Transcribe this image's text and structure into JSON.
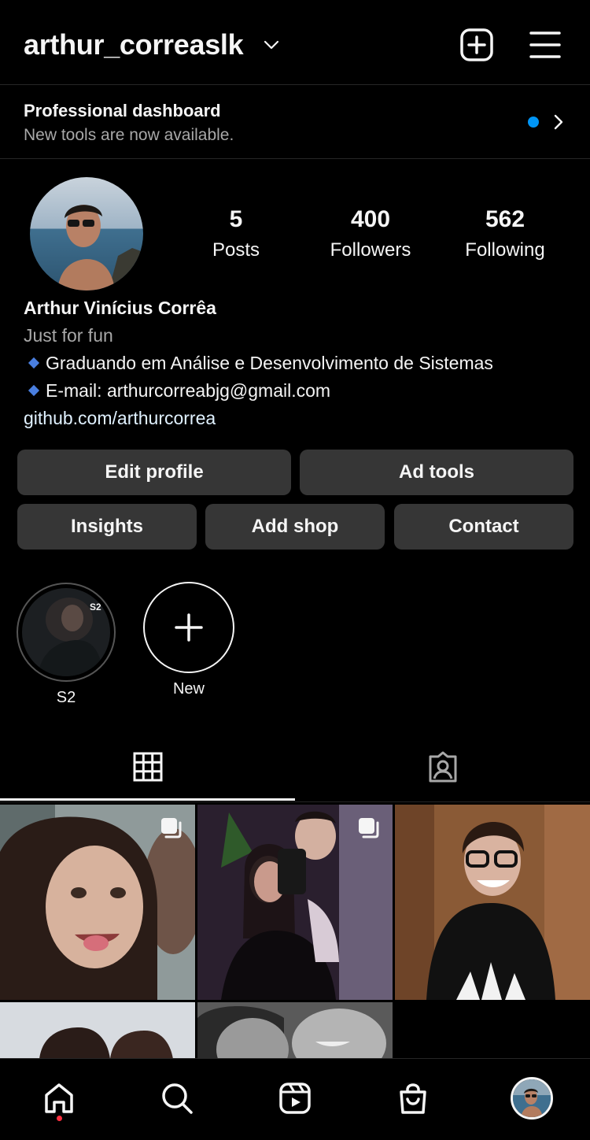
{
  "header": {
    "username": "arthur_correaslk",
    "icons": {
      "chevron": "chevron-down-icon",
      "add": "add-post-icon",
      "menu": "hamburger-menu-icon"
    }
  },
  "dashboard": {
    "title": "Professional dashboard",
    "subtitle": "New tools are now available.",
    "dot_color": "#0095f6"
  },
  "profile": {
    "stats": [
      {
        "value": "5",
        "label": "Posts"
      },
      {
        "value": "400",
        "label": "Followers"
      },
      {
        "value": "562",
        "label": "Following"
      }
    ],
    "name": "Arthur Vinícius Corrêa",
    "category": "Just for fun",
    "bio_lines": [
      "Graduando em Análise e Desenvolvimento de Sistemas",
      "E-mail: arthurcorreabjg@gmail.com"
    ],
    "link": "github.com/arthurcorrea",
    "bullet_color": "#4a7fe0"
  },
  "actions": {
    "row1": [
      "Edit profile",
      "Ad tools"
    ],
    "row2": [
      "Insights",
      "Add shop",
      "Contact"
    ]
  },
  "highlights": [
    {
      "label": "S2",
      "badge": "S2"
    },
    {
      "label": "New"
    }
  ],
  "tabs": {
    "grid_icon": "grid-icon",
    "tagged_icon": "tagged-icon",
    "active": "grid"
  },
  "bottom_nav": {
    "items": [
      "home-icon",
      "search-icon",
      "reels-icon",
      "shop-icon",
      "profile-avatar"
    ],
    "notification_color": "#ff3040"
  },
  "colors": {
    "background": "#000000",
    "button": "#363636",
    "secondary_text": "#a8a8a8",
    "link": "#e0f1ff"
  }
}
